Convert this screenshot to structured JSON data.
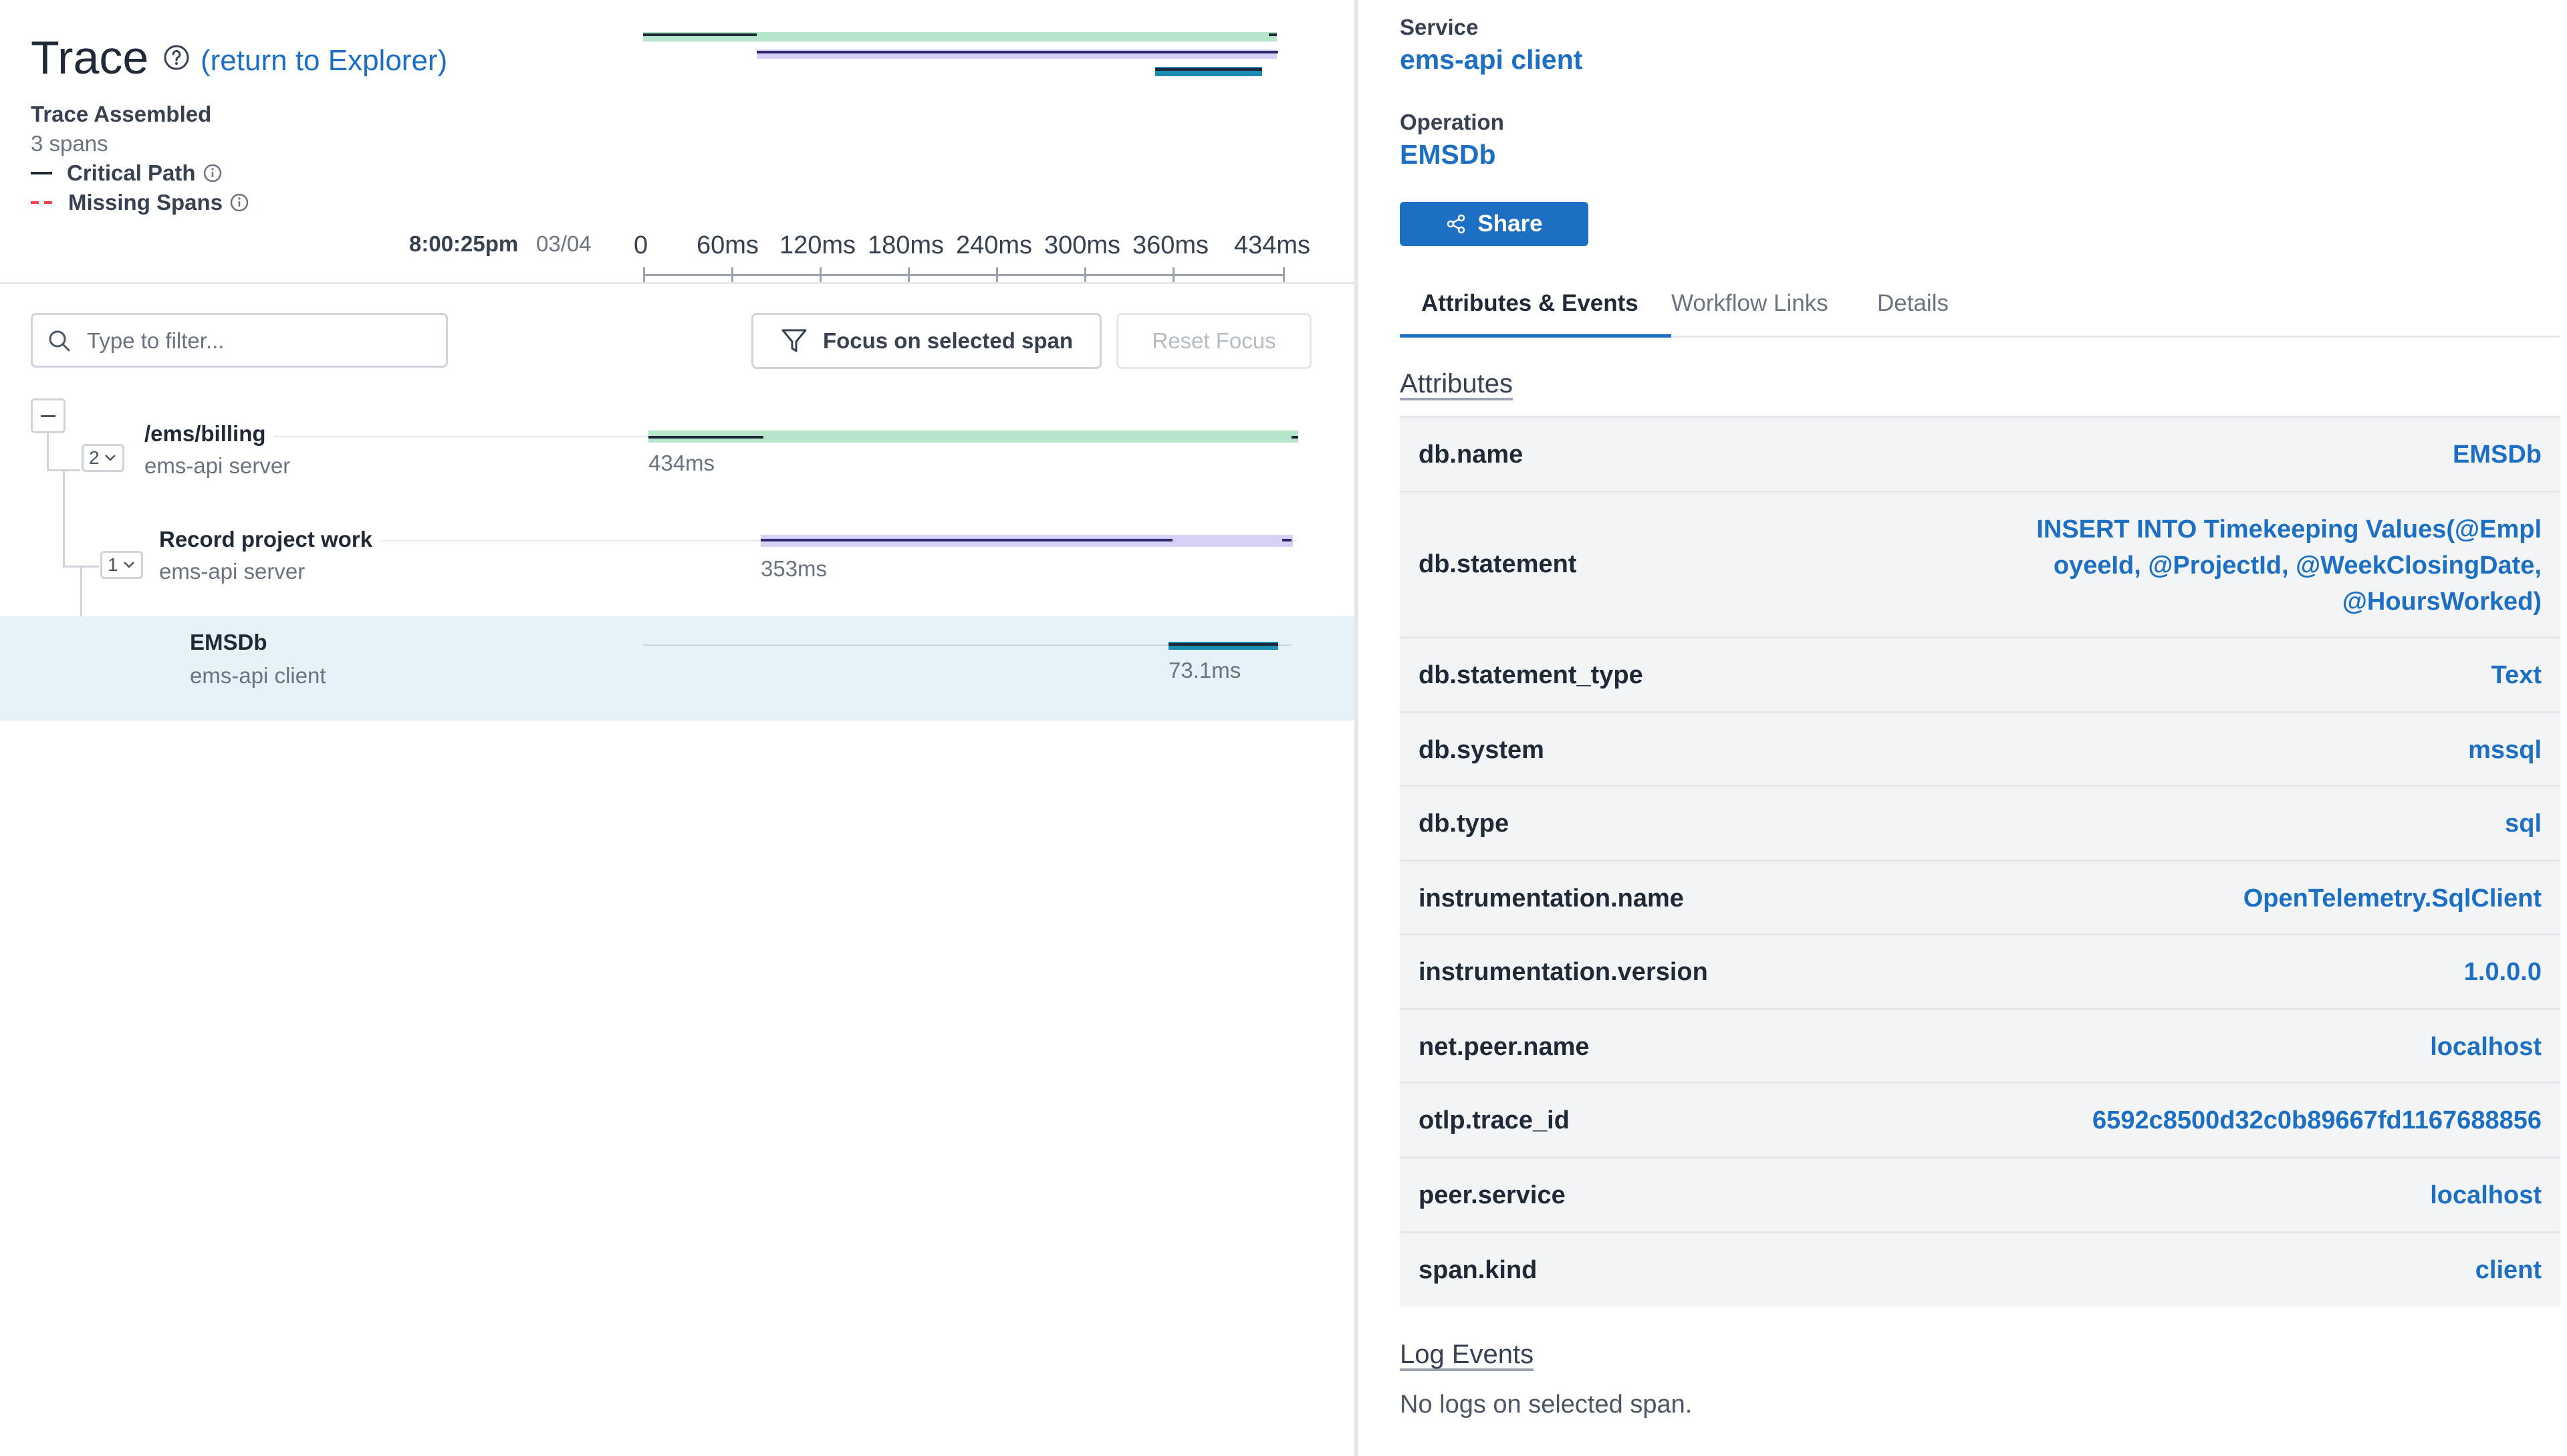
{
  "trace": {
    "title": "Trace",
    "return_link": "(return to Explorer)",
    "status": "Trace Assembled",
    "span_count": "3 spans",
    "legend": {
      "critical_path": "Critical Path",
      "missing_spans": "Missing Spans"
    },
    "start_time": "8:00:25pm",
    "start_date": "03/04"
  },
  "timeline": {
    "ticks": [
      "0",
      "60ms",
      "120ms",
      "180ms",
      "240ms",
      "300ms",
      "360ms",
      "434ms"
    ]
  },
  "filter": {
    "placeholder": "Type to filter..."
  },
  "buttons": {
    "focus": "Focus on selected span",
    "reset": "Reset Focus"
  },
  "spans": [
    {
      "name": "/ems/billing",
      "service": "ems-api server",
      "duration": "434ms",
      "children_count": "2",
      "color": "#b5e6cc"
    },
    {
      "name": "Record project work",
      "service": "ems-api server",
      "duration": "353ms",
      "children_count": "1",
      "color": "#d6d2f7"
    },
    {
      "name": "EMSDb",
      "service": "ems-api client",
      "duration": "73.1ms",
      "color": "#1b8ab0",
      "selected": true
    }
  ],
  "details": {
    "service_label": "Service",
    "service_value": "ems-api client",
    "operation_label": "Operation",
    "operation_value": "EMSDb",
    "share_label": "Share",
    "tabs": [
      "Attributes & Events",
      "Workflow Links",
      "Details"
    ],
    "active_tab": "Attributes & Events",
    "attributes_title": "Attributes",
    "attributes": [
      {
        "key": "db.name",
        "value": "EMSDb"
      },
      {
        "key": "db.statement",
        "value_lines": [
          "INSERT INTO Timekeeping Values(@Empl",
          "oyeeId, @ProjectId, @WeekClosingDate,",
          "@HoursWorked)"
        ]
      },
      {
        "key": "db.statement_type",
        "value": "Text"
      },
      {
        "key": "db.system",
        "value": "mssql"
      },
      {
        "key": "db.type",
        "value": "sql"
      },
      {
        "key": "instrumentation.name",
        "value": "OpenTelemetry.SqlClient"
      },
      {
        "key": "instrumentation.version",
        "value": "1.0.0.0"
      },
      {
        "key": "net.peer.name",
        "value": "localhost"
      },
      {
        "key": "otlp.trace_id",
        "value": "6592c8500d32c0b89667fd1167688856"
      },
      {
        "key": "peer.service",
        "value": "localhost"
      },
      {
        "key": "span.kind",
        "value": "client"
      }
    ],
    "log_events_title": "Log Events",
    "no_logs": "No logs on selected span."
  },
  "colors": {
    "accent": "#1d6fc4",
    "selected_row": "#e6f2f8",
    "critical_path": "#1f2937"
  }
}
